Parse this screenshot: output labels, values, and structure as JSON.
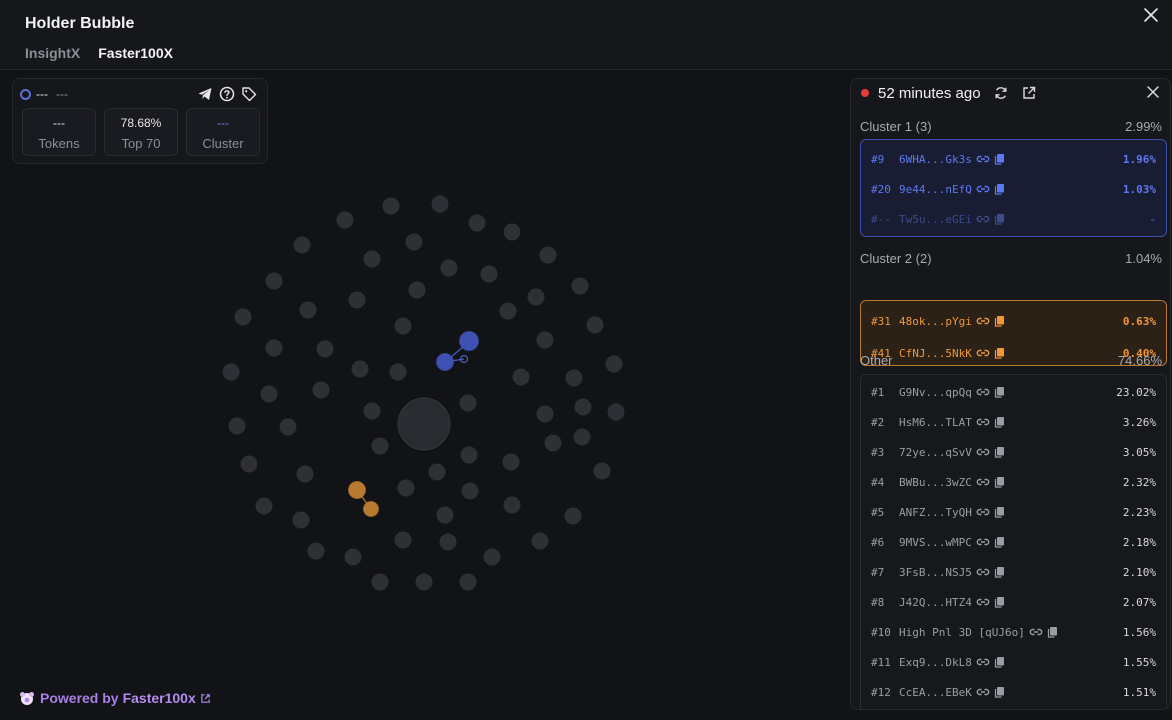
{
  "header": {
    "title": "Holder Bubble",
    "tabs": [
      {
        "label": "InsightX",
        "active": false
      },
      {
        "label": "Faster100X",
        "active": true
      }
    ]
  },
  "stats": {
    "selected_name": "---",
    "selected_sub": "---",
    "boxes": [
      {
        "value": "---",
        "label": "Tokens"
      },
      {
        "value": "78.68%",
        "label": "Top 70"
      },
      {
        "value": "---",
        "label": "Cluster"
      }
    ]
  },
  "footer": {
    "powered_prefix": "Powered by",
    "powered_brand": "Faster100x"
  },
  "panel": {
    "updated": "52 minutes ago",
    "clusters": [
      {
        "label": "Cluster 1 (3)",
        "share": "2.99%",
        "color": "#5d78f0",
        "rows": [
          {
            "rank": "#9",
            "addr": "6WHA...Gk3s",
            "pct": "1.96%"
          },
          {
            "rank": "#20",
            "addr": "9e44...nEfQ",
            "pct": "1.03%"
          },
          {
            "rank": "#--",
            "addr": "Tw5u...eGEi",
            "pct": "-"
          }
        ]
      },
      {
        "label": "Cluster 2 (2)",
        "share": "1.04%",
        "color": "#f1973a",
        "rows": [
          {
            "rank": "#31",
            "addr": "48ok...pYgi",
            "pct": "0.63%"
          },
          {
            "rank": "#41",
            "addr": "CfNJ...5NkK",
            "pct": "0.40%"
          }
        ]
      }
    ],
    "other": {
      "label": "Other",
      "share": "74.66%",
      "rows": [
        {
          "rank": "#1",
          "addr": "G9Nv...qpQq",
          "pct": "23.02%"
        },
        {
          "rank": "#2",
          "addr": "HsM6...TLAT",
          "pct": "3.26%"
        },
        {
          "rank": "#3",
          "addr": "72ye...qSvV",
          "pct": "3.05%"
        },
        {
          "rank": "#4",
          "addr": "BWBu...3wZC",
          "pct": "2.32%"
        },
        {
          "rank": "#5",
          "addr": "ANFZ...TyQH",
          "pct": "2.23%"
        },
        {
          "rank": "#6",
          "addr": "9MVS...wMPC",
          "pct": "2.18%"
        },
        {
          "rank": "#7",
          "addr": "3FsB...NSJ5",
          "pct": "2.10%"
        },
        {
          "rank": "#8",
          "addr": "J42Q...HTZ4",
          "pct": "2.07%"
        },
        {
          "rank": "#10",
          "addr": "High Pnl 3D [qUJ6o]",
          "pct": "1.56%"
        },
        {
          "rank": "#11",
          "addr": "Exq9...DkL8",
          "pct": "1.55%"
        },
        {
          "rank": "#12",
          "addr": "CcEA...EBeK",
          "pct": "1.51%"
        }
      ]
    }
  },
  "colors": {
    "bubble": "#2e3036",
    "center_bubble": "#2a2c31",
    "cluster1": "#3e51b3",
    "cluster2": "#b87a2e",
    "accent_purple": "#b58aef"
  }
}
